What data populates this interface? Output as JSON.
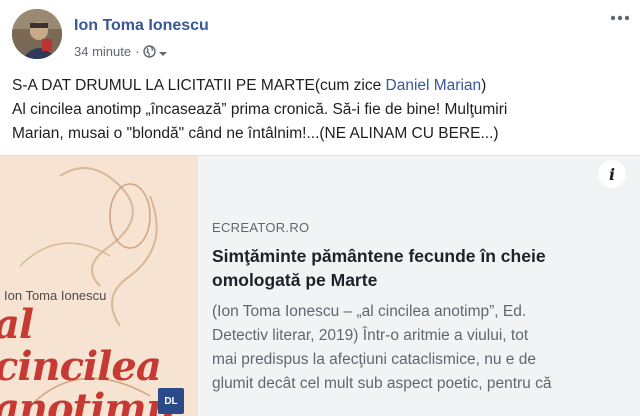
{
  "post": {
    "author_name": "Ion Toma Ionescu",
    "timestamp": "34 minute",
    "separator": "·",
    "privacy_icon": "globe-icon",
    "more_icon": "more-dots-icon",
    "text_line1_prefix": "S-A DAT DRUMUL LA LICITATII PE MARTE(cum zice ",
    "mention": "Daniel Marian",
    "text_line1_suffix": ")",
    "text_line2": "Al cincilea anotimp „încasează” prima cronică. Să-i fie de bine! Mulţumiri",
    "text_line3": "Marian, musai o \"blondă\" când ne întâlnim!...(NE ALINAM CU BERE...)"
  },
  "link_preview": {
    "cover": {
      "author": "Ion Toma Ionescu",
      "title_lines": [
        "al",
        "cincilea",
        "anotimp"
      ],
      "publisher_mark": "DL"
    },
    "info_icon": "i",
    "domain": "ECREATOR.RO",
    "title": "Simţăminte pământene fecunde în cheie omologată pe Marte",
    "description_lines": [
      "(Ion Toma Ionescu – „al cincilea anotimp”, Ed.",
      "Detectiv literar, 2019)            Într-o aritmie a viului, tot",
      "mai predispus la afecţiuni cataclismice, nu e de",
      "glumit decât cel mult sub aspect poetic, pentru că"
    ]
  },
  "colors": {
    "link_blue": "#385898",
    "preview_bg": "#f2f3f5",
    "cover_bg": "#f6e3d1",
    "cover_title_red": "#c73a33"
  }
}
